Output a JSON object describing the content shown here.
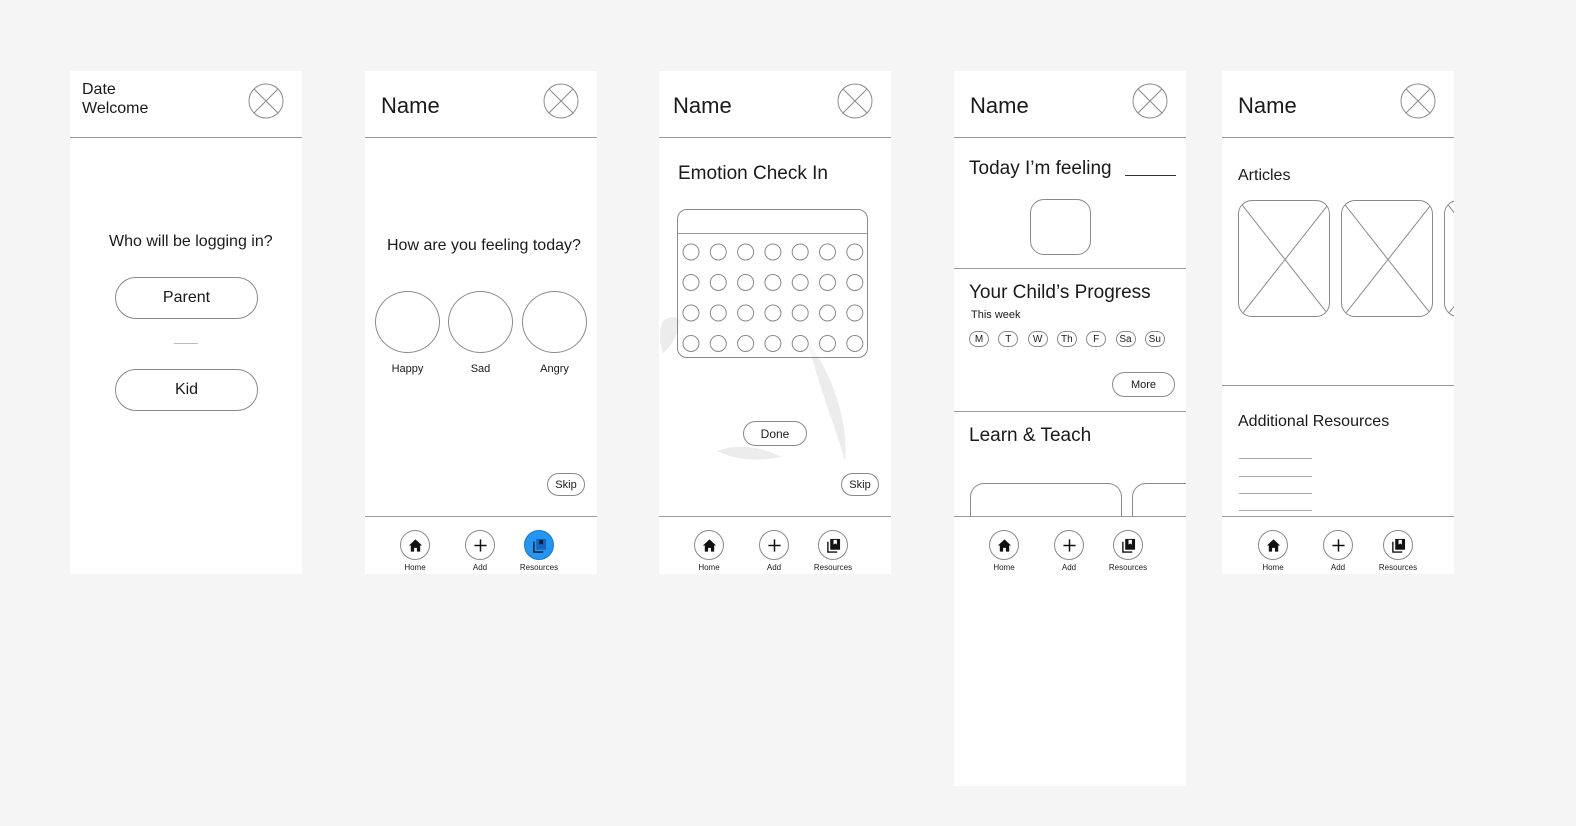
{
  "screens": {
    "login": {
      "date": "Date",
      "welcome": "Welcome",
      "question": "Who will be logging in?",
      "parent_button": "Parent",
      "kid_button": "Kid"
    },
    "feeling": {
      "title": "Name",
      "question": "How are you feeling today?",
      "emotions": [
        "Happy",
        "Sad",
        "Angry"
      ],
      "skip": "Skip"
    },
    "checkin": {
      "title": "Name",
      "heading": "Emotion Check In",
      "done": "Done",
      "skip": "Skip"
    },
    "progress": {
      "title": "Name",
      "feeling_prompt": "Today I’m feeling",
      "progress_heading": "Your Child’s Progress",
      "this_week": "This week",
      "days": [
        "M",
        "T",
        "W",
        "Th",
        "F",
        "Sa",
        "Su"
      ],
      "more": "More",
      "learn_heading": "Learn & Teach"
    },
    "resources": {
      "title": "Name",
      "articles_heading": "Articles",
      "additional_heading": "Additional Resources"
    }
  },
  "nav": {
    "home": "Home",
    "add": "Add",
    "resources": "Resources"
  },
  "colors": {
    "background": "#f5f5f5",
    "screen": "#ffffff",
    "active_resources": "#2196f3"
  },
  "icons": {
    "close": "circle-x-icon",
    "home": "house-icon",
    "add": "plus-icon",
    "resources": "stacked-pages-icon"
  }
}
